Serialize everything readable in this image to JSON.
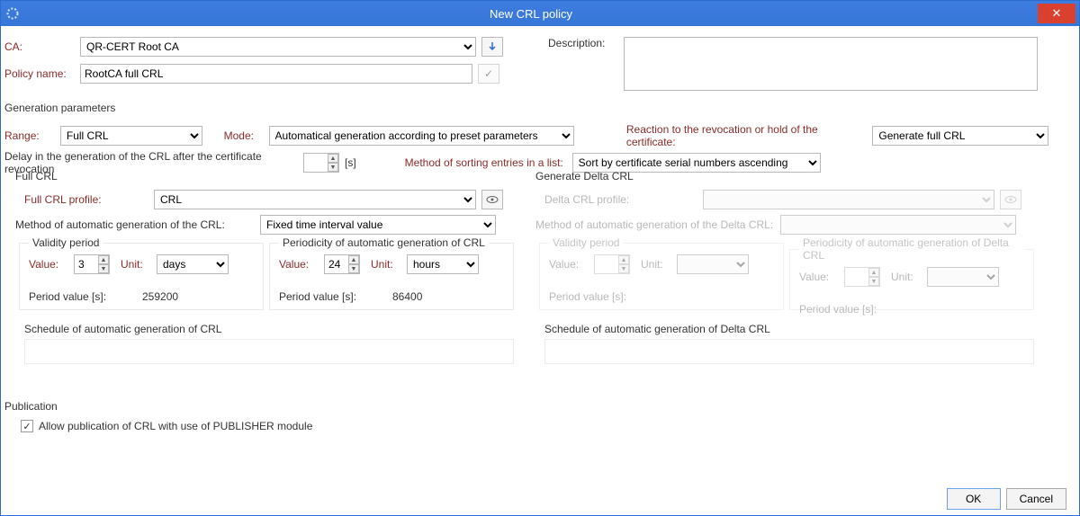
{
  "window": {
    "title": "New CRL policy"
  },
  "top": {
    "ca_label": "CA:",
    "ca_value": "QR-CERT Root CA",
    "policy_label": "Policy name:",
    "policy_value": "RootCA full CRL",
    "desc_label": "Description:",
    "desc_value": ""
  },
  "genparams": {
    "heading": "Generation parameters",
    "range_label": "Range:",
    "range_value": "Full CRL",
    "mode_label": "Mode:",
    "mode_value": "Automatical generation according to preset parameters",
    "reaction_label": "Reaction to the revocation or hold of the certificate:",
    "reaction_value": "Generate full CRL",
    "delay_label": "Delay in the generation of the CRL after the certificate revocation",
    "delay_value": "",
    "delay_unit": "[s]",
    "sort_label": "Method of sorting entries in a list:",
    "sort_value": "Sort by certificate serial numbers ascending"
  },
  "fullcrl": {
    "legend": "Full CRL",
    "profile_label": "Full CRL profile:",
    "profile_value": "CRL",
    "method_label": "Method of automatic generation of the CRL:",
    "method_value": "Fixed time interval value",
    "validity_legend": "Validity period",
    "value_label": "Value:",
    "value": "3",
    "unit_label": "Unit:",
    "unit": "days",
    "pv_label": "Period value [s]:",
    "pv": "259200",
    "periodicity_legend": "Periodicity of automatic generation of CRL",
    "p_value": "24",
    "p_unit": "hours",
    "p_pv": "86400",
    "schedule_label": "Schedule of automatic generation of CRL"
  },
  "deltacrl": {
    "legend": "Generate Delta CRL",
    "profile_label": "Delta CRL profile:",
    "profile_value": "",
    "method_label": "Method of automatic generation of the Delta CRL:",
    "method_value": "",
    "validity_legend": "Validity period",
    "value_label": "Value:",
    "value": "",
    "unit_label": "Unit:",
    "unit": "",
    "pv_label": "Period value [s]:",
    "pv": "",
    "periodicity_legend": "Periodicity of automatic generation of Delta CRL",
    "p_value": "",
    "p_unit": "",
    "p_pv": "",
    "schedule_label": "Schedule of automatic generation of Delta CRL"
  },
  "publication": {
    "heading": "Publication",
    "allow_label": "Allow publication of CRL with use of PUBLISHER module",
    "allow_checked": true
  },
  "buttons": {
    "ok": "OK",
    "cancel": "Cancel"
  }
}
